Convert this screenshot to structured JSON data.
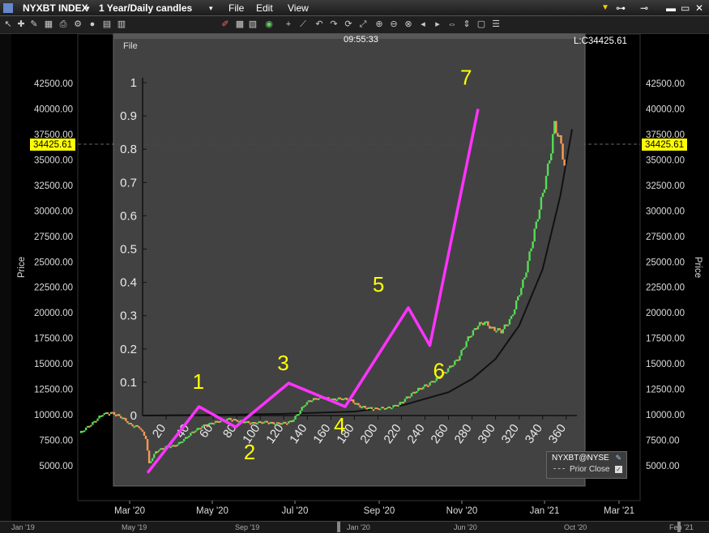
{
  "window": {
    "symbol": "NYXBT INDEX",
    "timeframe": "1 Year/Daily candles",
    "menus": [
      "File",
      "Edit",
      "View"
    ]
  },
  "inner_panel": {
    "menu": "File",
    "time": "09:55:33",
    "last": "L:C34425.61"
  },
  "price_flag": "34425.61",
  "axis_label": "Price",
  "legend": {
    "symbol": "NYXBT@NYSE",
    "item": "Prior Close"
  },
  "bottom_labels": [
    "Jan '19",
    "May '19",
    "Sep '19",
    "Jan '20",
    "Jun '20",
    "Oct '20",
    "Feb '21"
  ],
  "colors": {
    "up": "#55dd55",
    "down": "#ff9955",
    "elliott": "#ff33ff",
    "annotation": "#ffff00",
    "fit": "#111111"
  },
  "chart_data": [
    {
      "type": "candlestick",
      "y_ticks": [
        5000,
        7500,
        10000,
        12500,
        15000,
        17500,
        20000,
        22500,
        25000,
        27500,
        30000,
        32500,
        35000,
        37500,
        40000,
        42500
      ],
      "y_tick_labels": [
        "5000.00",
        "7500.00",
        "10000.00",
        "12500.00",
        "15000.00",
        "17500.00",
        "20000.00",
        "22500.00",
        "25000.00",
        "27500.00",
        "30000.00",
        "32500.00",
        "35000.00",
        "37500.00",
        "40000.00",
        "42500.00"
      ],
      "ylim": [
        2300,
        45000
      ],
      "ylabel": "Price",
      "x_ticks": [
        "Mar '20",
        "May '20",
        "Jul '20",
        "Sep '20",
        "Nov '20",
        "Jan '21",
        "Mar '21"
      ],
      "last_price": 34425.61,
      "price_path": [
        [
          0,
          8200
        ],
        [
          8,
          9200
        ],
        [
          14,
          10100
        ],
        [
          20,
          10200
        ],
        [
          26,
          9700
        ],
        [
          31,
          9000
        ],
        [
          36,
          8800
        ],
        [
          40,
          7700
        ],
        [
          42,
          5200
        ],
        [
          46,
          6400
        ],
        [
          52,
          6900
        ],
        [
          58,
          7000
        ],
        [
          63,
          7600
        ],
        [
          68,
          8300
        ],
        [
          74,
          8900
        ],
        [
          82,
          9300
        ],
        [
          90,
          9600
        ],
        [
          96,
          9400
        ],
        [
          104,
          9200
        ],
        [
          112,
          9300
        ],
        [
          118,
          9150
        ],
        [
          124,
          9200
        ],
        [
          128,
          9400
        ],
        [
          132,
          10200
        ],
        [
          136,
          11100
        ],
        [
          140,
          11500
        ],
        [
          146,
          11700
        ],
        [
          152,
          11500
        ],
        [
          158,
          11600
        ],
        [
          164,
          11400
        ],
        [
          168,
          10900
        ],
        [
          172,
          10700
        ],
        [
          178,
          10600
        ],
        [
          186,
          10700
        ],
        [
          192,
          11000
        ],
        [
          198,
          11800
        ],
        [
          204,
          12500
        ],
        [
          210,
          13000
        ],
        [
          216,
          13600
        ],
        [
          222,
          14500
        ],
        [
          228,
          15500
        ],
        [
          234,
          17500
        ],
        [
          240,
          18800
        ],
        [
          244,
          19100
        ],
        [
          248,
          18500
        ],
        [
          254,
          18200
        ],
        [
          260,
          19500
        ],
        [
          264,
          21500
        ],
        [
          268,
          23500
        ],
        [
          272,
          26500
        ],
        [
          276,
          29500
        ],
        [
          280,
          32500
        ],
        [
          284,
          36000
        ],
        [
          286,
          38500
        ],
        [
          288,
          37500
        ],
        [
          290,
          36500
        ],
        [
          292,
          34425.61
        ]
      ]
    },
    {
      "type": "line",
      "x_ticks": [
        20,
        40,
        60,
        80,
        100,
        120,
        140,
        160,
        180,
        200,
        220,
        240,
        260,
        280,
        300,
        320,
        340,
        360
      ],
      "y_ticks": [
        0,
        0.1,
        0.2,
        0.3,
        0.4,
        0.5,
        0.6,
        0.7,
        0.8,
        0.9,
        1
      ],
      "ylim": [
        0,
        1
      ],
      "xlim": [
        0,
        365
      ],
      "series": [
        {
          "x": [
            0,
            60,
            120,
            180,
            220,
            260,
            280,
            300,
            320,
            340,
            355,
            365
          ],
          "values": [
            0,
            0.002,
            0.005,
            0.012,
            0.03,
            0.07,
            0.11,
            0.17,
            0.27,
            0.44,
            0.66,
            0.86
          ]
        }
      ]
    }
  ],
  "elliott_wave": {
    "labels": [
      "1",
      "2",
      "3",
      "4",
      "5",
      "6",
      "7"
    ],
    "points": [
      [
        41,
        4300
      ],
      [
        72,
        10800
      ],
      [
        94,
        8800
      ],
      [
        126,
        13100
      ],
      [
        160,
        10800
      ],
      [
        198,
        20500
      ],
      [
        211,
        16800
      ],
      [
        240,
        40000
      ]
    ]
  }
}
